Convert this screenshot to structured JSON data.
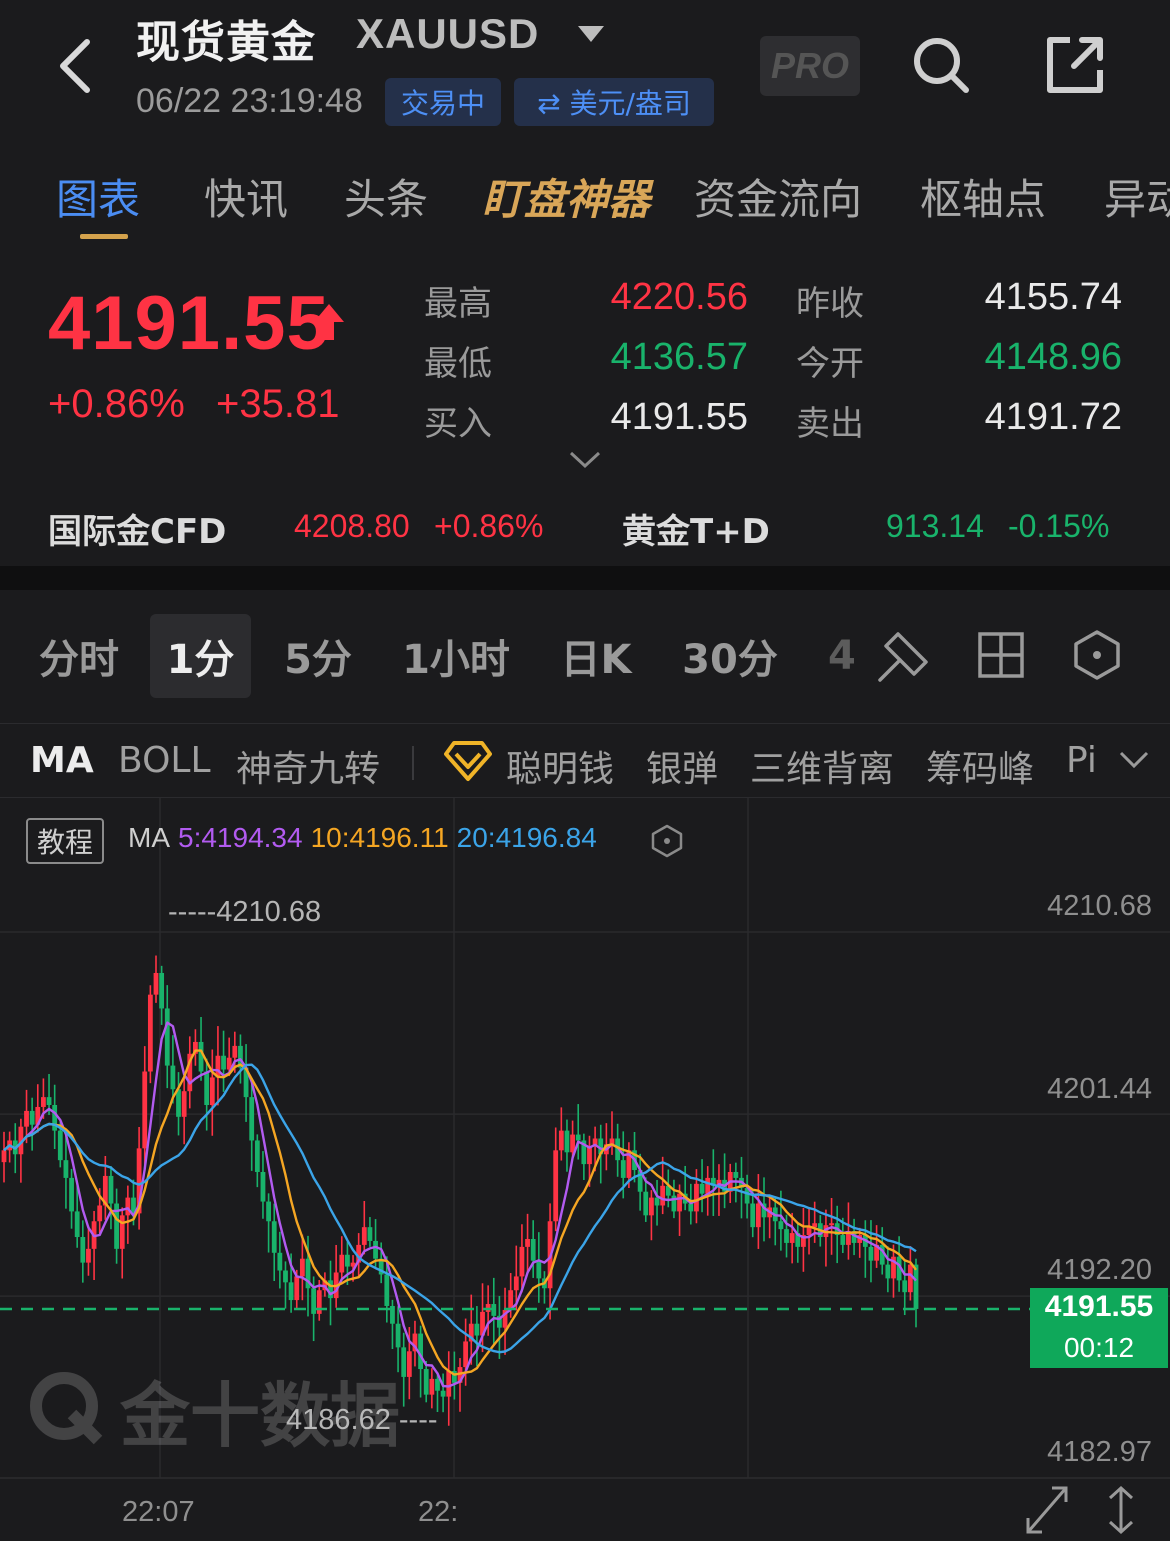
{
  "header": {
    "title": "现货黄金",
    "symbol": "XAUUSD",
    "datetime": "06/22 23:19:48",
    "trading_status": "交易中",
    "unit": "⇄ 美元/盎司",
    "pro_label": "PRO"
  },
  "tabs": [
    "图表",
    "快讯",
    "头条",
    "盯盘神器",
    "资金流向",
    "枢轴点",
    "异动"
  ],
  "quote": {
    "last": "4191.55",
    "change_pct": "+0.86%",
    "change_abs": "+35.81",
    "high_label": "最高",
    "high": "4220.56",
    "low_label": "最低",
    "low": "4136.57",
    "bid_label": "买入",
    "bid": "4191.55",
    "prev_close_label": "昨收",
    "prev_close": "4155.74",
    "open_label": "今开",
    "open": "4148.96",
    "ask_label": "卖出",
    "ask": "4191.72"
  },
  "related": {
    "cfd_label": "国际金CFD",
    "cfd_price": "4208.80",
    "cfd_pct": "+0.86%",
    "td_label": "黄金T+D",
    "td_price": "913.14",
    "td_pct": "-0.15%"
  },
  "periods": [
    "分时",
    "1分",
    "5分",
    "1小时",
    "日K",
    "30分",
    "4"
  ],
  "indicators": [
    "MA",
    "BOLL",
    "神奇九转",
    "聪明钱",
    "银弹",
    "三维背离",
    "筹码峰",
    "Pi"
  ],
  "chart": {
    "tutorial_label": "教程",
    "ma_label": "MA",
    "ma5": "5:4194.34",
    "ma10": "10:4196.11",
    "ma20": "20:4196.84",
    "y_labels": [
      "4210.68",
      "4201.44",
      "4192.20",
      "4182.97"
    ],
    "x_labels": [
      "22:07",
      "22:"
    ],
    "max_marker": "-----4210.68",
    "min_marker": "4186.62 ----",
    "current_price": "4191.55",
    "countdown": "00:12",
    "watermark": "金十数据",
    "colors": {
      "up": "#ff3344",
      "down": "#19b36b",
      "ma5": "#b25bf0",
      "ma10": "#f5a623",
      "ma20": "#3ba4e8"
    }
  },
  "chart_data": {
    "type": "candlestick",
    "interval": "1分",
    "ylim": [
      4182.97,
      4210.68
    ],
    "y_ticks": [
      4210.68,
      4201.44,
      4192.2,
      4182.97
    ],
    "x_ticks": [
      "22:07",
      "22:"
    ],
    "max_price": 4210.68,
    "min_price": 4186.62,
    "last_price": 4191.55,
    "series_close": [
      4199.6,
      4200.1,
      4199.4,
      4200.8,
      4201.6,
      4200.9,
      4201.8,
      4202.3,
      4201.9,
      4200.6,
      4199.1,
      4198.2,
      4196.5,
      4195.2,
      4193.9,
      4194.6,
      4196.0,
      4196.8,
      4198.3,
      4196.9,
      4194.6,
      4196.3,
      4197.2,
      4196.4,
      4199.7,
      4203.6,
      4207.5,
      4208.6,
      4206.8,
      4203.9,
      4202.7,
      4201.3,
      4202.6,
      4204.5,
      4205.1,
      4203.6,
      4201.9,
      4203.3,
      4204.4,
      4203.7,
      4204.3,
      4204.9,
      4203.8,
      4202.3,
      4200.1,
      4198.5,
      4197.0,
      4196.0,
      4194.4,
      4193.5,
      4192.9,
      4192.0,
      4193.2,
      4194.1,
      4192.6,
      4191.3,
      4192.5,
      4193.0,
      4192.1,
      4193.4,
      4194.3,
      4193.7,
      4193.9,
      4194.8,
      4195.7,
      4195.0,
      4194.1,
      4193.3,
      4191.7,
      4190.8,
      4189.6,
      4188.1,
      4189.4,
      4190.3,
      4188.5,
      4187.2,
      4188.0,
      4187.4,
      4187.1,
      4188.4,
      4187.8,
      4188.6,
      4189.9,
      4190.8,
      4190.2,
      4191.4,
      4191.8,
      4191.2,
      4190.6,
      4191.5,
      4192.5,
      4193.2,
      4194.7,
      4195.1,
      4194.0,
      4193.1,
      4192.6,
      4196.0,
      4199.6,
      4200.6,
      4199.5,
      4200.4,
      4200.1,
      4198.9,
      4199.8,
      4200.2,
      4199.4,
      4199.9,
      4200.2,
      4199.1,
      4198.2,
      4199.6,
      4198.6,
      4197.5,
      4196.3,
      4197.2,
      4196.8,
      4197.8,
      4197.3,
      4196.5,
      4197.4,
      4196.9,
      4196.5,
      4197.9,
      4197.4,
      4198.2,
      4197.8,
      4198.1,
      4197.5,
      4198.5,
      4198.2,
      4197.7,
      4196.9,
      4195.7,
      4196.9,
      4196.2,
      4196.7,
      4196.0,
      4195.6,
      4194.9,
      4195.4,
      4194.7,
      4195.3,
      4195.7,
      4195.9,
      4195.2,
      4195.8,
      4195.9,
      4195.3,
      4194.8,
      4195.5,
      4194.9,
      4195.3,
      4194.7,
      4194.0,
      4194.8,
      4193.8,
      4193.1,
      4194.2,
      4193.0,
      4192.4,
      4193.8,
      4191.55
    ]
  }
}
